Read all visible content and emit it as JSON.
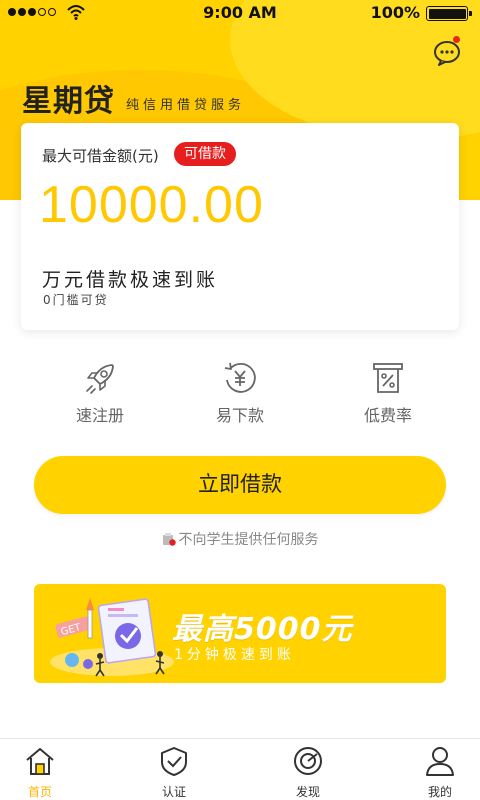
{
  "status_bar": {
    "time": "9:00 AM",
    "battery": "100%"
  },
  "brand": {
    "name": "星期贷",
    "tagline": "纯信用借贷服务"
  },
  "card": {
    "amount_label": "最大可借金额(元)",
    "badge": "可借款",
    "amount": "10000.00",
    "headline": "万元借款极速到账",
    "subline": "0门槛可贷"
  },
  "features": [
    {
      "label": "速注册",
      "icon": "rocket-icon"
    },
    {
      "label": "易下款",
      "icon": "yuan-refresh-icon"
    },
    {
      "label": "低费率",
      "icon": "percent-receipt-icon"
    }
  ],
  "borrow_button": "立即借款",
  "notice": "不向学生提供任何服务",
  "banner": {
    "title": "最高5000元",
    "subtitle": "1分钟极速到账",
    "art_text": "GET"
  },
  "tabs": [
    {
      "label": "首页",
      "icon": "home-icon",
      "active": true
    },
    {
      "label": "认证",
      "icon": "shield-check-icon",
      "active": false
    },
    {
      "label": "发现",
      "icon": "compass-icon",
      "active": false
    },
    {
      "label": "我的",
      "icon": "user-icon",
      "active": false
    }
  ],
  "colors": {
    "brand_yellow": "#ffd200",
    "amount_yellow": "#ffc800",
    "badge_red": "#e61e1e",
    "active_tab": "#ffb400"
  }
}
